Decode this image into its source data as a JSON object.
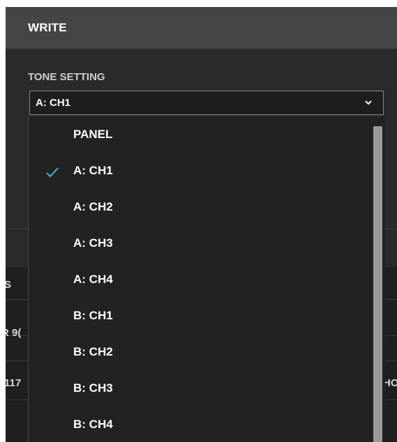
{
  "dialog": {
    "title": "WRITE"
  },
  "tone_setting": {
    "label": "TONE SETTING",
    "selected_value": "A: CH1"
  },
  "dropdown": {
    "options": [
      {
        "label": "PANEL",
        "checked": false
      },
      {
        "label": "A: CH1",
        "checked": true
      },
      {
        "label": "A: CH2",
        "checked": false
      },
      {
        "label": "A: CH3",
        "checked": false
      },
      {
        "label": "A: CH4",
        "checked": false
      },
      {
        "label": "B: CH1",
        "checked": false
      },
      {
        "label": "B: CH2",
        "checked": false
      },
      {
        "label": "B: CH3",
        "checked": false
      },
      {
        "label": "B: CH4",
        "checked": false
      }
    ]
  },
  "background_partial_text": {
    "row1_left": "S",
    "row2_left": "R 9(",
    "row3_left": "117",
    "row3_right": "HO"
  },
  "colors": {
    "check_accent": "#3fb6d6",
    "header_bg": "#454545",
    "dialog_bg": "#2a2a2a"
  },
  "icons": {
    "select_chevron": "chevron-down-icon",
    "selected_marker": "check-icon"
  }
}
